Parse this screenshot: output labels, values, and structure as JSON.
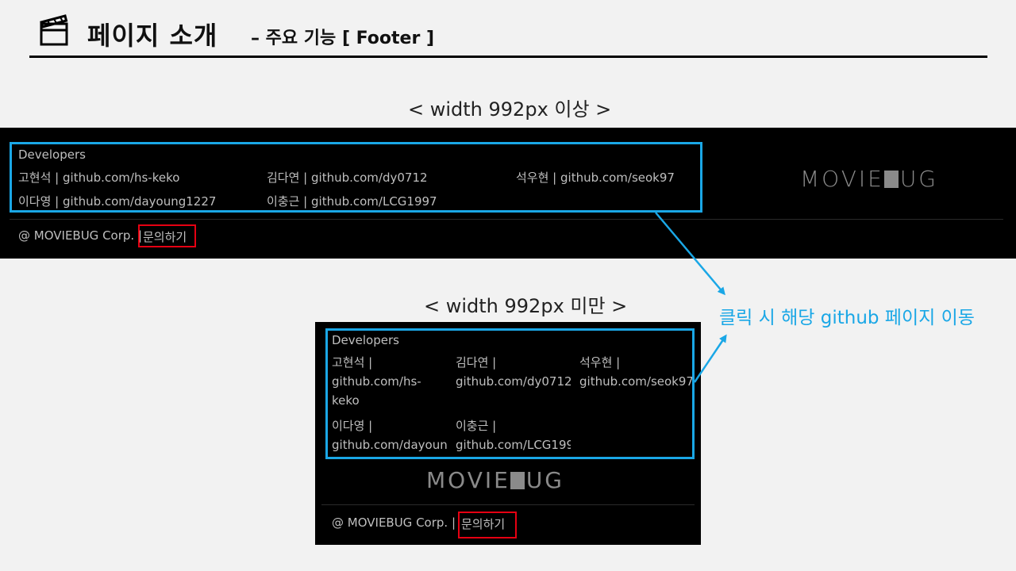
{
  "header": {
    "title": "페이지 소개",
    "subtitle": "– 주요 기능 [ Footer ]"
  },
  "wide": {
    "caption": "< width 992px 이상 >",
    "developers_label": "Developers",
    "developers": [
      {
        "name": "고현석",
        "link": "github.com/hs-keko"
      },
      {
        "name": "김다연",
        "link": "github.com/dy0712"
      },
      {
        "name": "석우현",
        "link": "github.com/seok97"
      },
      {
        "name": "이다영",
        "link": "github.com/dayoung1227"
      },
      {
        "name": "이충근",
        "link": "github.com/LCG1997"
      }
    ],
    "logo_left": "MOVIE",
    "logo_right": "UG",
    "copyright": "@ MOVIEBUG Corp. |",
    "contact": "문의하기"
  },
  "narrow": {
    "caption": "< width 992px 미만 >",
    "developers_label": "Developers",
    "cells": [
      {
        "line1": "고현석 |",
        "line2": "github.com/hs-",
        "line3": "keko"
      },
      {
        "line1": "김다연 |",
        "line2": "github.com/dy0712"
      },
      {
        "line1": "석우현 |",
        "line2": "github.com/seok97"
      },
      {
        "line1": "이다영 |",
        "line2": "github.com/dayoun("
      },
      {
        "line1": "이충근 |",
        "line2": "github.com/LCG199"
      }
    ],
    "logo_left": "MOVIE",
    "logo_right": "UG",
    "copyright": "@ MOVIEBUG Corp. |",
    "contact": "문의하기"
  },
  "annotation": "클릭 시 해당 github 페이지 이동",
  "colors": {
    "highlight_blue": "#1aa7e6",
    "highlight_red": "#e60012",
    "footer_bg": "#000000"
  },
  "icons": {
    "header_icon": "clapperboard-icon"
  }
}
